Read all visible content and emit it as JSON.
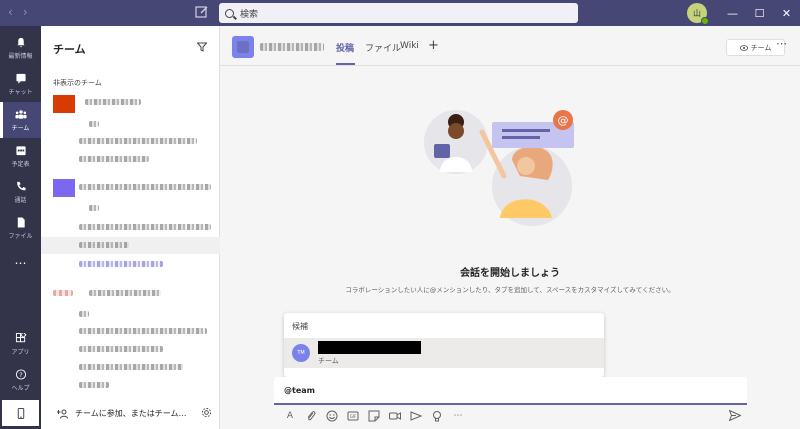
{
  "titlebar": {
    "search_placeholder": "検索",
    "user_initials": "山",
    "window_buttons": [
      "—",
      "☐",
      "✕"
    ]
  },
  "rail": {
    "items": [
      {
        "label": "最新情報",
        "icon": "bell-icon"
      },
      {
        "label": "チャット",
        "icon": "chat-icon"
      },
      {
        "label": "チーム",
        "icon": "teams-icon",
        "active": true
      },
      {
        "label": "予定表",
        "icon": "calendar-icon"
      },
      {
        "label": "通話",
        "icon": "phone-icon"
      },
      {
        "label": "ファイル",
        "icon": "file-icon"
      },
      {
        "label": "…",
        "icon": "more-icon"
      }
    ],
    "bottom": [
      {
        "label": "アプリ",
        "icon": "apps-icon"
      },
      {
        "label": "ヘルプ",
        "icon": "help-icon"
      }
    ]
  },
  "panel": {
    "title": "チーム",
    "hidden_teams_label": "非表示のチーム",
    "join_label": "チームに参加、またはチーム…"
  },
  "channel": {
    "tabs": [
      "投稿",
      "ファイル",
      "Wiki"
    ],
    "team_button": "チーム"
  },
  "main": {
    "welcome_title": "会話を開始しましょう",
    "welcome_sub": "コラボレーションしたい人に@メンションしたり、タブを追加して、スペースをカスタマイズしてみてください。"
  },
  "suggest": {
    "label": "候補",
    "item_avatar": "TM",
    "item_type": "チーム"
  },
  "compose": {
    "text": "@team"
  },
  "colors": {
    "brand": "#6264a7",
    "titlebar": "#464775",
    "rail": "#33344a"
  }
}
